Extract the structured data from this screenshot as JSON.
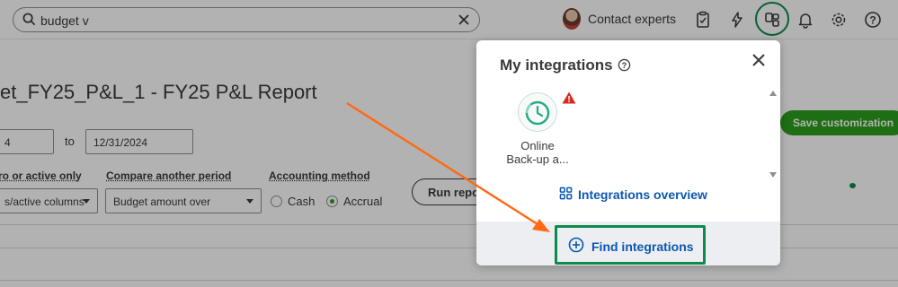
{
  "topbar": {
    "search_value": "budget v",
    "contact_label": "Contact experts",
    "icons": [
      "search-icon",
      "clear-icon",
      "clipboard-icon",
      "lightning-icon",
      "apps-icon",
      "bell-icon",
      "gear-icon",
      "help-icon"
    ]
  },
  "report": {
    "title": "et_FY25_P&L_1 - FY25 P&L Report",
    "date_from": "4",
    "to_label": "to",
    "date_to": "12/31/2024",
    "filters": {
      "columns_label": "ro or active only",
      "columns_value": "s/active columns",
      "compare_label": "Compare another period",
      "compare_value": "Budget amount over",
      "method_label": "Accounting method",
      "cash_label": "Cash",
      "accrual_label": "Accrual",
      "selected_method": "Accrual"
    },
    "run_label": "Run report",
    "save_label": "Save customization"
  },
  "integrations": {
    "title": "My integrations",
    "apps": [
      {
        "name": "Online Back-up a...",
        "status": "warning"
      }
    ],
    "overview_link": "Integrations overview",
    "find_link": "Find integrations"
  },
  "colors": {
    "accent_green": "#2ca01c",
    "highlight_green": "#0d8a4e",
    "link_blue": "#0b57b1",
    "arrow_orange": "#ff6a13",
    "warning_red": "#d52b1e"
  }
}
